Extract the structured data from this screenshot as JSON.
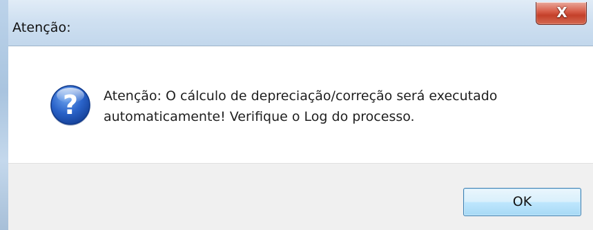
{
  "window": {
    "title": "Atenção:",
    "close_glyph": "X"
  },
  "dialog": {
    "icon": "question-icon",
    "message_line1": "Atenção: O cálculo de depreciação/correção será executado",
    "message_line2": "automaticamente! Verifique o Log do processo."
  },
  "buttons": {
    "ok_label": "OK"
  },
  "colors": {
    "titlebar": "#cfe0f1",
    "close_button": "#c4402a",
    "button_panel": "#f0f0f0",
    "icon_blue": "#1f56b8"
  }
}
